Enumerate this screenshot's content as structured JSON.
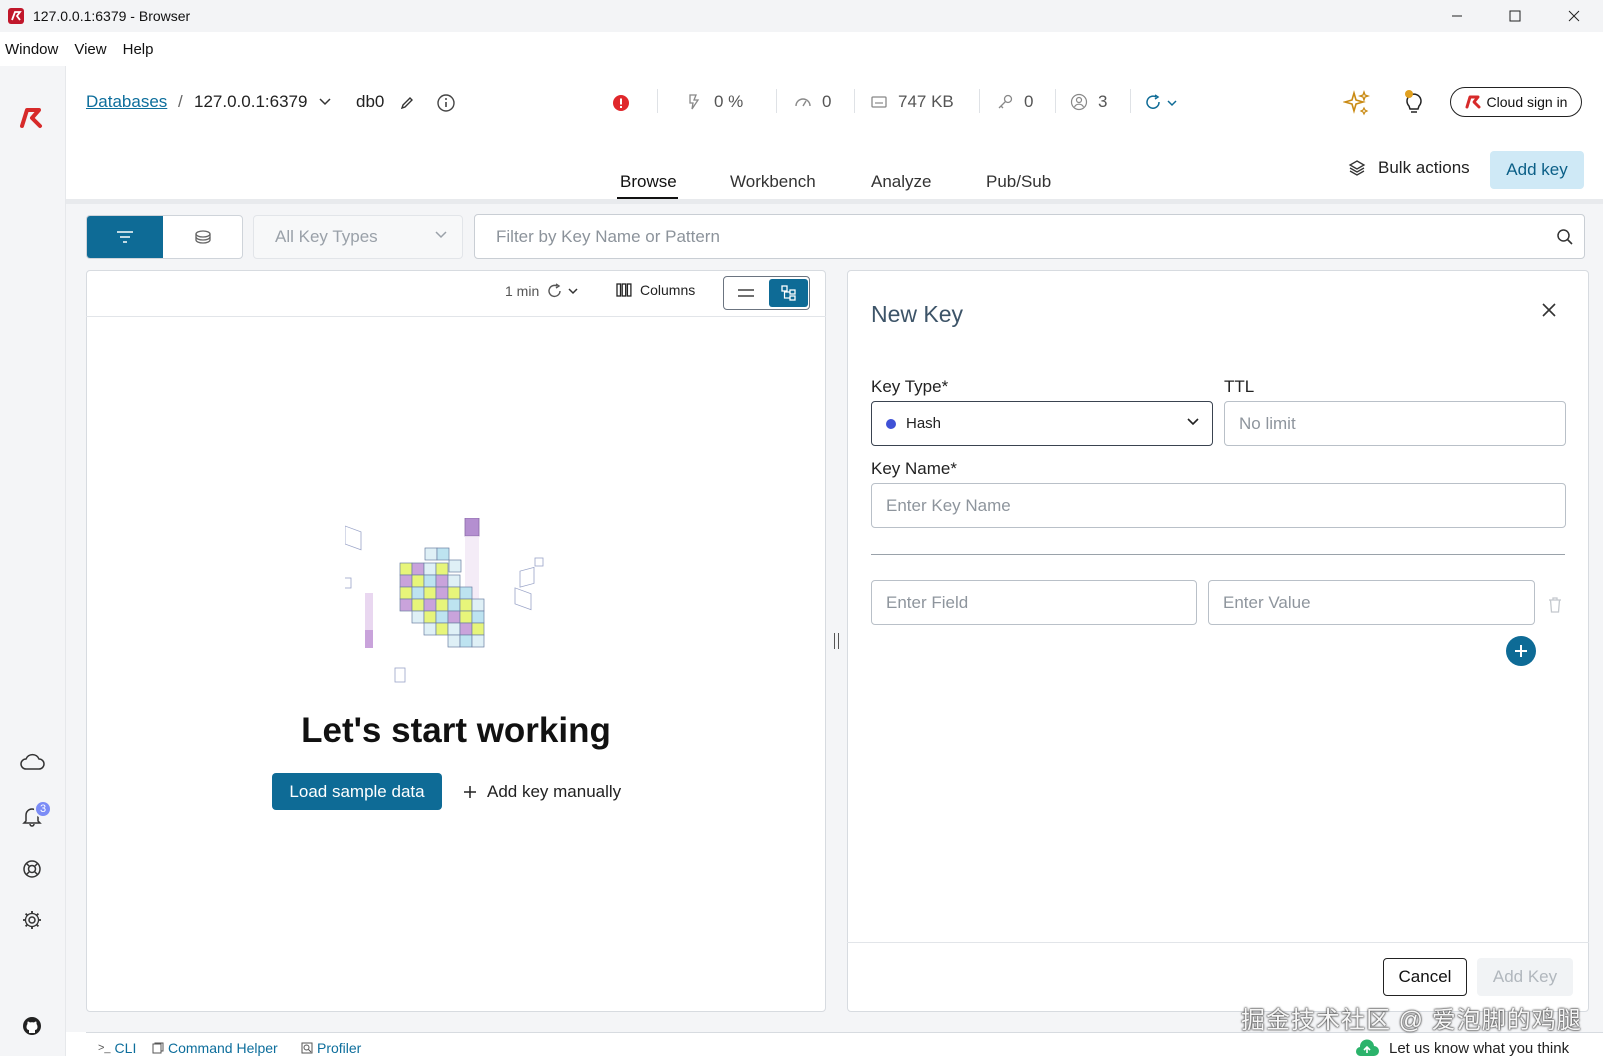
{
  "window": {
    "title": "127.0.0.1:6379 - Browser"
  },
  "menu": [
    "Window",
    "View",
    "Help"
  ],
  "header": {
    "databases_link": "Databases",
    "breadcrumb_sep": "/",
    "db_address": "127.0.0.1:6379",
    "db_index": "db0",
    "stats": {
      "cpu": "0 %",
      "ops": "0",
      "memory": "747 KB",
      "keys": "0",
      "clients": "3"
    },
    "cloud_sign_in": "Cloud sign in"
  },
  "sidebar": {
    "notification_count": "3"
  },
  "tabs": [
    {
      "label": "Browse",
      "active": true
    },
    {
      "label": "Workbench",
      "active": false
    },
    {
      "label": "Analyze",
      "active": false
    },
    {
      "label": "Pub/Sub",
      "active": false
    }
  ],
  "toolbar": {
    "bulk_actions": "Bulk actions",
    "add_key": "Add key"
  },
  "filter": {
    "key_types": "All Key Types",
    "search_placeholder": "Filter by Key Name or Pattern"
  },
  "list_panel": {
    "refresh_interval": "1 min",
    "columns_label": "Columns",
    "empty_title": "Let's start working",
    "load_sample": "Load sample data",
    "add_manually": "Add key manually"
  },
  "new_key": {
    "title": "New Key",
    "key_type_label": "Key Type*",
    "key_type_value": "Hash",
    "ttl_label": "TTL",
    "ttl_placeholder": "No limit",
    "key_name_label": "Key Name*",
    "key_name_placeholder": "Enter Key Name",
    "field_placeholder": "Enter Field",
    "value_placeholder": "Enter Value",
    "cancel": "Cancel",
    "submit": "Add Key"
  },
  "bottom_bar": {
    "cli": "CLI",
    "command_helper": "Command Helper",
    "profiler": "Profiler",
    "feedback": "Let us know what you think"
  },
  "watermark": "掘金技术社区 @ 爱泡脚的鸡腿",
  "colors": {
    "primary": "#0e6b96",
    "brand_red": "#d72a2a",
    "hash_dot": "#3f51d6"
  }
}
